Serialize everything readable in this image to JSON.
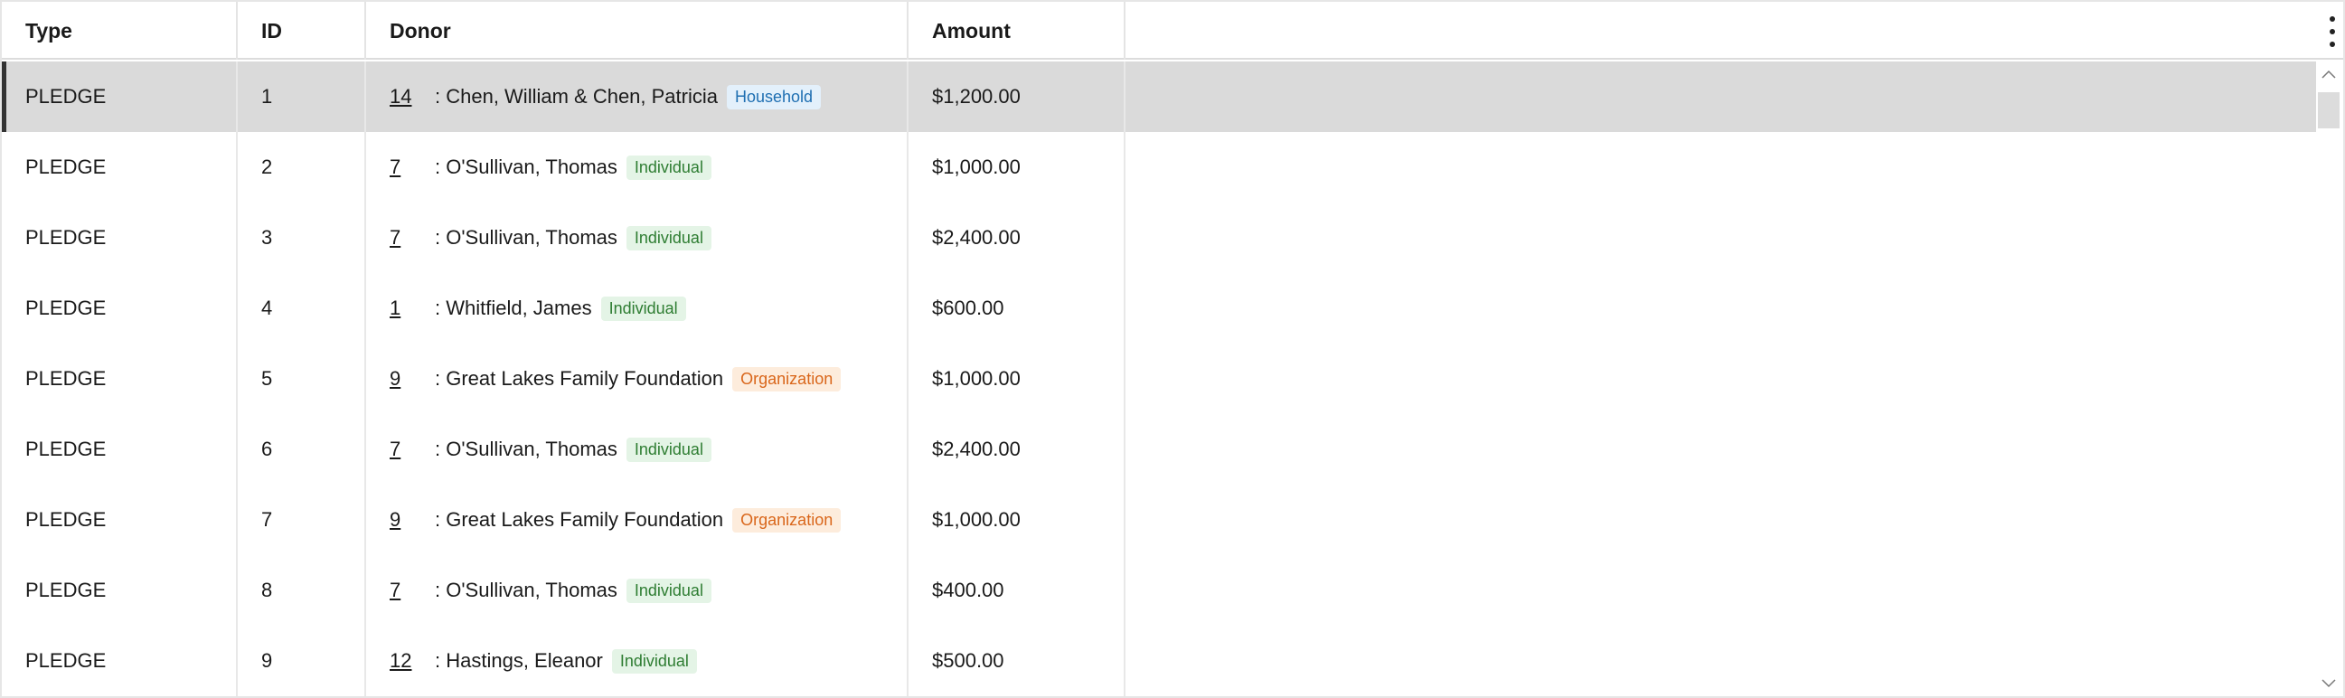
{
  "table": {
    "columns": [
      "Type",
      "ID",
      "Donor",
      "Amount"
    ],
    "rows": [
      {
        "type": "PLEDGE",
        "id": "1",
        "donor_id": "14",
        "donor_name": ": Chen, William & Chen, Patricia",
        "donor_kind": "Household",
        "amount": "$1,200.00",
        "selected": true
      },
      {
        "type": "PLEDGE",
        "id": "2",
        "donor_id": "7",
        "donor_name": ": O'Sullivan, Thomas",
        "donor_kind": "Individual",
        "amount": "$1,000.00"
      },
      {
        "type": "PLEDGE",
        "id": "3",
        "donor_id": "7",
        "donor_name": ": O'Sullivan, Thomas",
        "donor_kind": "Individual",
        "amount": "$2,400.00"
      },
      {
        "type": "PLEDGE",
        "id": "4",
        "donor_id": "1",
        "donor_name": ": Whitfield, James",
        "donor_kind": "Individual",
        "amount": "$600.00"
      },
      {
        "type": "PLEDGE",
        "id": "5",
        "donor_id": "9",
        "donor_name": ": Great Lakes Family Foundation",
        "donor_kind": "Organization",
        "amount": "$1,000.00"
      },
      {
        "type": "PLEDGE",
        "id": "6",
        "donor_id": "7",
        "donor_name": ": O'Sullivan, Thomas",
        "donor_kind": "Individual",
        "amount": "$2,400.00"
      },
      {
        "type": "PLEDGE",
        "id": "7",
        "donor_id": "9",
        "donor_name": ": Great Lakes Family Foundation",
        "donor_kind": "Organization",
        "amount": "$1,000.00"
      },
      {
        "type": "PLEDGE",
        "id": "8",
        "donor_id": "7",
        "donor_name": ": O'Sullivan, Thomas",
        "donor_kind": "Individual",
        "amount": "$400.00"
      },
      {
        "type": "PLEDGE",
        "id": "9",
        "donor_id": "12",
        "donor_name": ": Hastings, Eleanor",
        "donor_kind": "Individual",
        "amount": "$500.00"
      }
    ]
  },
  "icons": {
    "menu": "more-vertical-icon",
    "scroll_up": "chevron-up-icon",
    "scroll_down": "chevron-down-icon"
  },
  "colors": {
    "selected_row": "#dadada",
    "household": "#1f6fb2",
    "individual": "#2e7d32",
    "organization": "#d9661a"
  }
}
